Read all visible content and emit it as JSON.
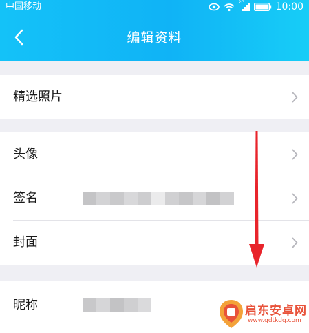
{
  "status_bar": {
    "carrier": "中国移动",
    "network_badge": "2G",
    "time": "10:00",
    "icons": [
      "eye-icon",
      "wifi-icon",
      "signal-icon",
      "battery-icon"
    ]
  },
  "header": {
    "title": "编辑资料",
    "back_icon": "chevron-left-icon",
    "gradient_colors": [
      "#14c2f8",
      "#10b3f6",
      "#17cdf7"
    ]
  },
  "sections": {
    "photos": {
      "label": "精选照片"
    },
    "profile": {
      "avatar_label": "头像",
      "signature_label": "签名",
      "cover_label": "封面"
    },
    "nickname": {
      "label": "昵称"
    }
  },
  "annotation": {
    "arrow_color": "#e8242b",
    "direction": "down"
  },
  "watermark": {
    "text": "启东安卓网",
    "url": "www.qdtkdq.com",
    "color": "#e8523a"
  }
}
